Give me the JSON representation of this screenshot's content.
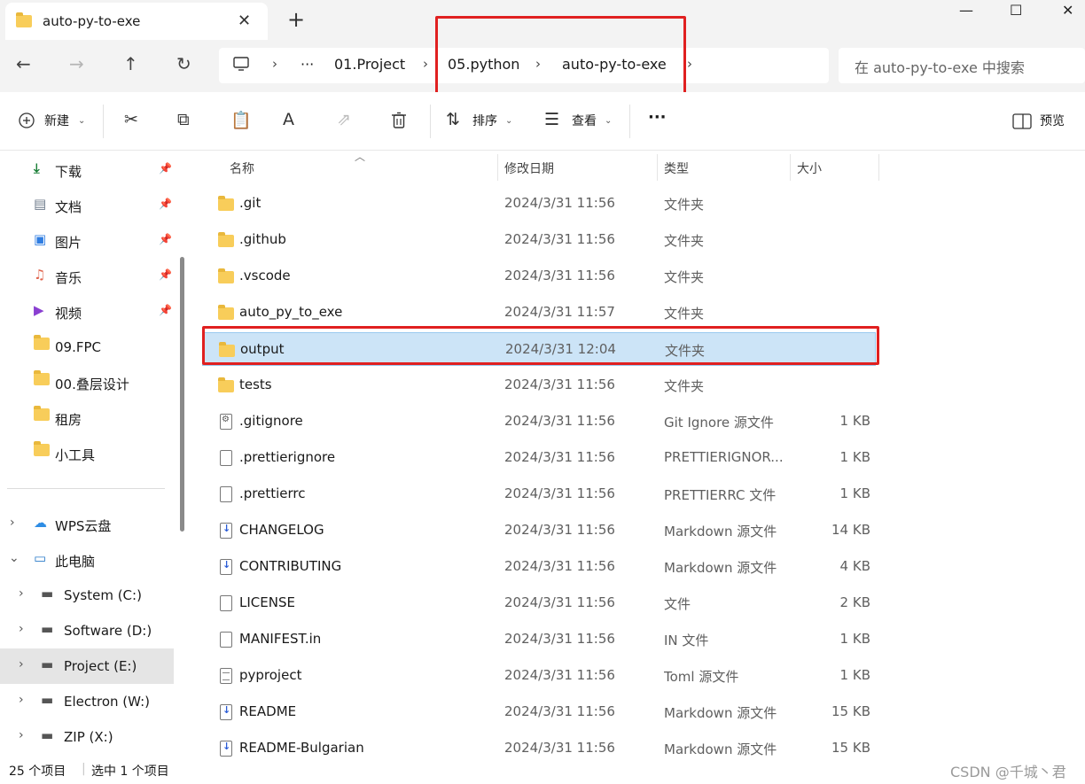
{
  "window": {
    "tab_title": "auto-py-to-exe",
    "close_tab": "✕",
    "new_tab": "+",
    "minimize": "—",
    "maximize": "☐",
    "close": "✕"
  },
  "nav": {
    "back": "←",
    "forward": "→",
    "up": "↑",
    "refresh": "↻",
    "breadcrumb": [
      "01.Project",
      "05.python",
      "auto-py-to-exe"
    ],
    "search_placeholder": "在 auto-py-to-exe 中搜索"
  },
  "toolbar": {
    "new_label": "新建",
    "sort_label": "排序",
    "view_label": "查看",
    "more_label": "···",
    "preview_label": "预览"
  },
  "sidebar": {
    "quick_access": [
      {
        "label": "下载",
        "icon": "download-icon",
        "pinned": true
      },
      {
        "label": "文档",
        "icon": "document-icon",
        "pinned": true
      },
      {
        "label": "图片",
        "icon": "pictures-icon",
        "pinned": true
      },
      {
        "label": "音乐",
        "icon": "music-icon",
        "pinned": true
      },
      {
        "label": "视频",
        "icon": "video-icon",
        "pinned": true
      },
      {
        "label": "09.FPC",
        "icon": "folder-icon",
        "pinned": false
      },
      {
        "label": "00.叠层设计",
        "icon": "folder-icon",
        "pinned": false
      },
      {
        "label": "租房",
        "icon": "folder-icon",
        "pinned": false
      },
      {
        "label": "小工具",
        "icon": "folder-icon",
        "pinned": false
      }
    ],
    "tree": [
      {
        "label": "WPS云盘",
        "icon": "cloud-icon",
        "expanded": false
      },
      {
        "label": "此电脑",
        "icon": "computer-icon",
        "expanded": true
      },
      {
        "label": "System (C:)",
        "icon": "drive-icon",
        "expanded": false
      },
      {
        "label": "Software (D:)",
        "icon": "drive-icon",
        "expanded": false
      },
      {
        "label": "Project (E:)",
        "icon": "drive-icon",
        "expanded": false,
        "selected": true
      },
      {
        "label": "Electron (W:)",
        "icon": "drive-icon",
        "expanded": false
      },
      {
        "label": "ZIP (X:)",
        "icon": "drive-icon",
        "expanded": false
      }
    ]
  },
  "columns": {
    "name": "名称",
    "date": "修改日期",
    "type": "类型",
    "size": "大小"
  },
  "files": [
    {
      "name": ".git",
      "date": "2024/3/31 11:56",
      "type": "文件夹",
      "size": "",
      "icon": "folder-icon"
    },
    {
      "name": ".github",
      "date": "2024/3/31 11:56",
      "type": "文件夹",
      "size": "",
      "icon": "folder-icon"
    },
    {
      "name": ".vscode",
      "date": "2024/3/31 11:56",
      "type": "文件夹",
      "size": "",
      "icon": "folder-icon"
    },
    {
      "name": "auto_py_to_exe",
      "date": "2024/3/31 11:57",
      "type": "文件夹",
      "size": "",
      "icon": "folder-icon"
    },
    {
      "name": "output",
      "date": "2024/3/31 12:04",
      "type": "文件夹",
      "size": "",
      "icon": "folder-icon",
      "selected": true
    },
    {
      "name": "tests",
      "date": "2024/3/31 11:56",
      "type": "文件夹",
      "size": "",
      "icon": "folder-icon"
    },
    {
      "name": ".gitignore",
      "date": "2024/3/31 11:56",
      "type": "Git Ignore 源文件",
      "size": "1 KB",
      "icon": "config-file-icon"
    },
    {
      "name": ".prettierignore",
      "date": "2024/3/31 11:56",
      "type": "PRETTIERIGNOR...",
      "size": "1 KB",
      "icon": "file-icon"
    },
    {
      "name": ".prettierrc",
      "date": "2024/3/31 11:56",
      "type": "PRETTIERRC 文件",
      "size": "1 KB",
      "icon": "file-icon"
    },
    {
      "name": "CHANGELOG",
      "date": "2024/3/31 11:56",
      "type": "Markdown 源文件",
      "size": "14 KB",
      "icon": "markdown-file-icon"
    },
    {
      "name": "CONTRIBUTING",
      "date": "2024/3/31 11:56",
      "type": "Markdown 源文件",
      "size": "4 KB",
      "icon": "markdown-file-icon"
    },
    {
      "name": "LICENSE",
      "date": "2024/3/31 11:56",
      "type": "文件",
      "size": "2 KB",
      "icon": "file-icon"
    },
    {
      "name": "MANIFEST.in",
      "date": "2024/3/31 11:56",
      "type": "IN 文件",
      "size": "1 KB",
      "icon": "file-icon"
    },
    {
      "name": "pyproject",
      "date": "2024/3/31 11:56",
      "type": "Toml 源文件",
      "size": "1 KB",
      "icon": "text-file-icon"
    },
    {
      "name": "README",
      "date": "2024/3/31 11:56",
      "type": "Markdown 源文件",
      "size": "15 KB",
      "icon": "markdown-file-icon"
    },
    {
      "name": "README-Bulgarian",
      "date": "2024/3/31 11:56",
      "type": "Markdown 源文件",
      "size": "15 KB",
      "icon": "markdown-file-icon"
    }
  ],
  "status": {
    "item_count": "25 个项目",
    "selection": "选中 1 个项目",
    "watermark": "CSDN @千城丶君"
  },
  "colors": {
    "highlight": "#e02020",
    "selection_bg": "#cce4f7",
    "folder": "#f8cd5a"
  }
}
